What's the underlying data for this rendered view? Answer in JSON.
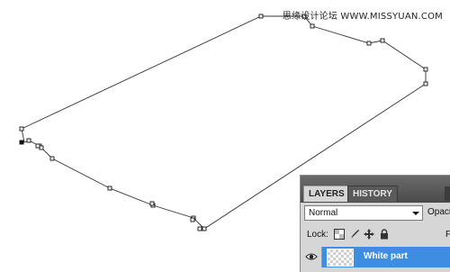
{
  "watermark": "思缘设计论坛 WWW.MISSYUAN.COM",
  "layers_panel": {
    "tabs": [
      {
        "label": "LAYERS",
        "active": true
      },
      {
        "label": "HISTORY",
        "active": false
      }
    ],
    "blend_mode": "Normal",
    "opacity_label": "Opaci",
    "lock_label": "Lock:",
    "lock_icons": [
      "lock-transparent-pixels-icon",
      "lock-image-pixels-icon",
      "lock-position-icon",
      "lock-all-icon"
    ],
    "fill_label": "F",
    "layers": [
      {
        "name": "White part",
        "visible": true,
        "selected": true
      }
    ]
  },
  "colors": {
    "selection": "#3d8ee0",
    "panel_bg": "#d6d6d6",
    "tabbar": "#555555"
  }
}
